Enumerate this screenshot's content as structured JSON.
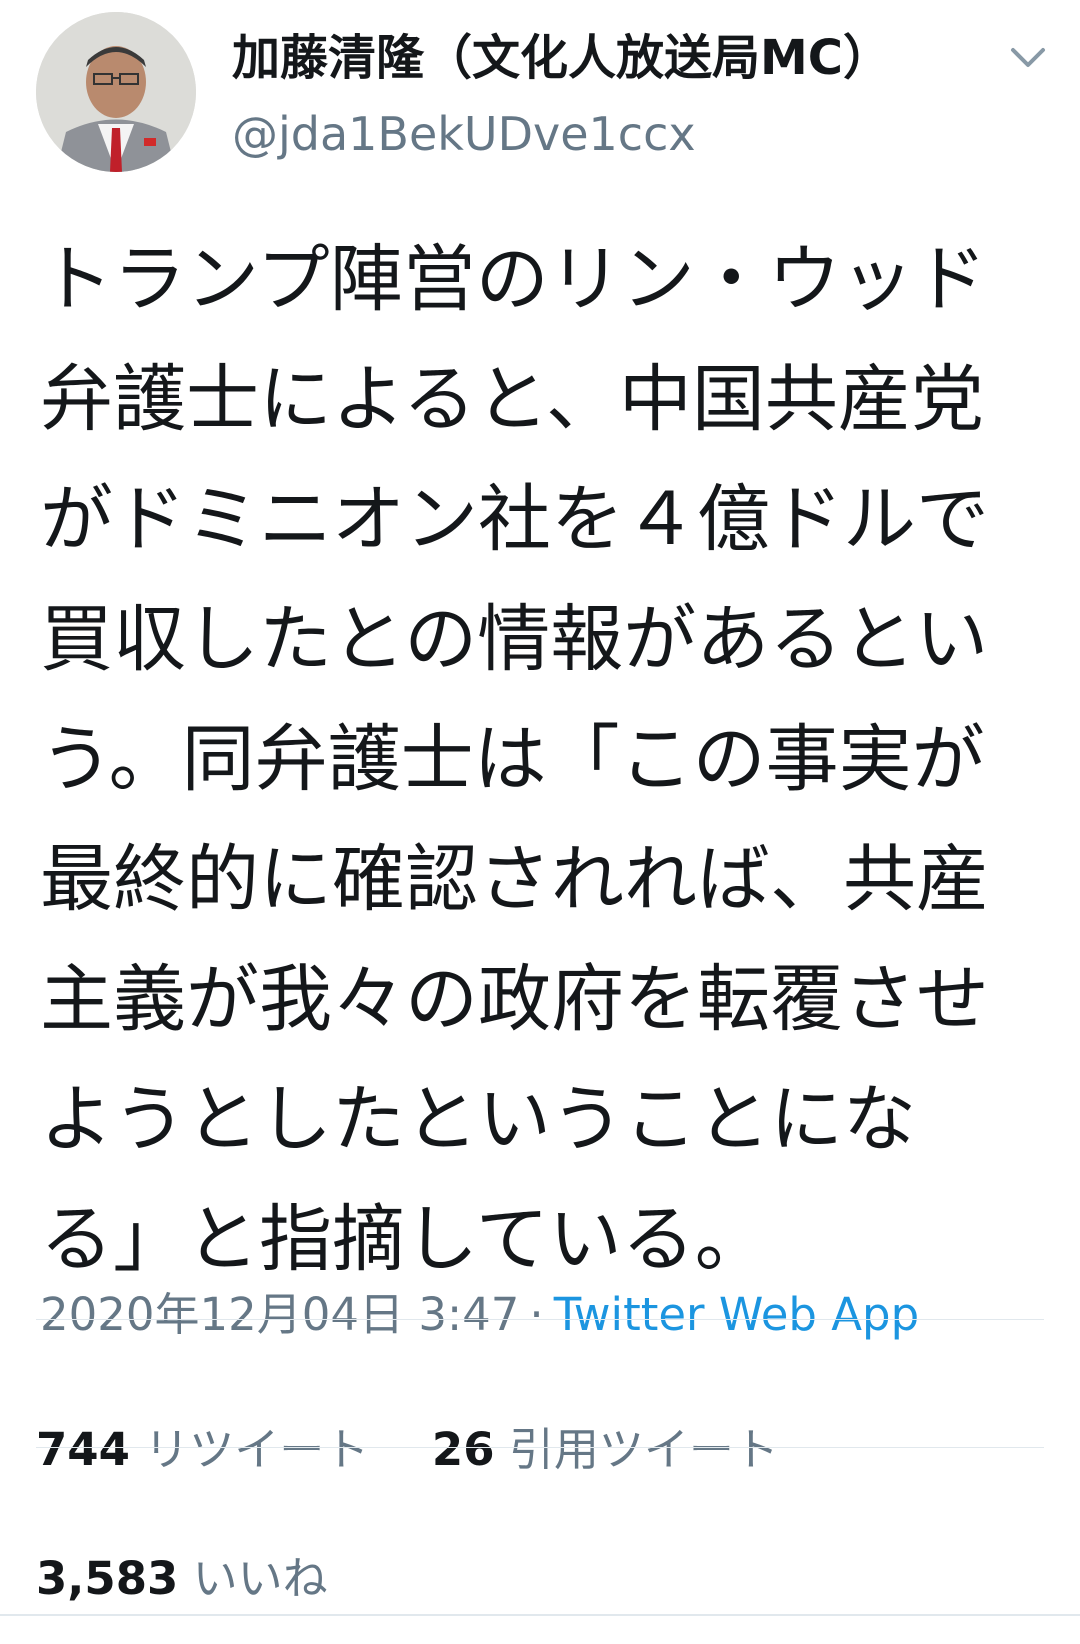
{
  "user": {
    "display_name": "加藤清隆（文化人放送局MC）",
    "handle": "@jda1BekUDve1ccx",
    "avatar_icon": "avatar-photo"
  },
  "tweet": {
    "lines": [
      "トランプ陣営のリン・ウッド",
      "弁護士によると、中国共産党",
      "がドミニオン社を４億ドルで",
      "買収したとの情報があるとい",
      "う。同弁護士は「この事実が",
      "最終的に確認されれば、共産",
      "主義が我々の政府を転覆させ",
      "ようとしたということにな",
      "る」と指摘している。"
    ]
  },
  "meta": {
    "timestamp": "2020年12月04日 3:47",
    "separator": "·",
    "source": "Twitter Web App"
  },
  "stats": {
    "retweets_count": "744",
    "retweets_label": "リツイート",
    "quotes_count": "26",
    "quotes_label": "引用ツイート",
    "likes_count": "3,583",
    "likes_label": "いいね"
  },
  "colors": {
    "primary_text": "#14171a",
    "secondary_text": "#657786",
    "link": "#1b95e0",
    "divider": "#e1e8ed"
  }
}
